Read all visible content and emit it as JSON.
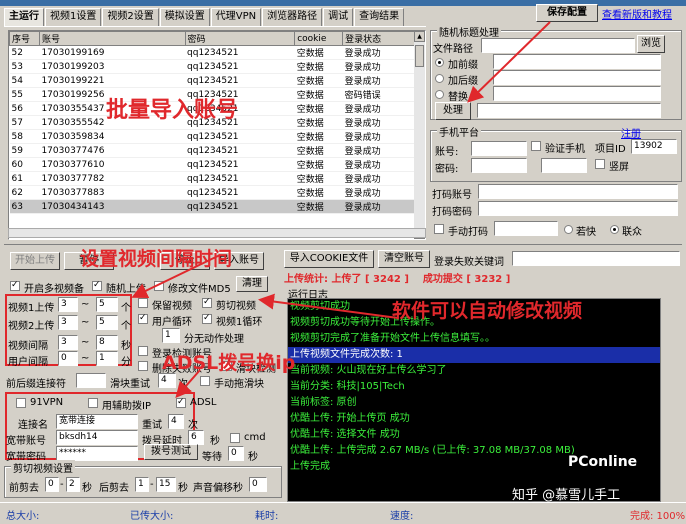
{
  "tabs": [
    "主运行",
    "视频1设置",
    "视频2设置",
    "模拟设置",
    "代理VPN",
    "浏览器路径",
    "调试",
    "查询结果"
  ],
  "save_label": "保存配置",
  "tutorial_link": "查看新版和教程",
  "grid": {
    "headers": [
      "序号",
      "账号",
      "密码",
      "cookie",
      "登录状态"
    ],
    "rows": [
      [
        "52",
        "17030199169",
        "qq1234521",
        "空数据",
        "登录成功"
      ],
      [
        "53",
        "17030199203",
        "qq1234521",
        "空数据",
        "登录成功"
      ],
      [
        "54",
        "17030199221",
        "qq1234521",
        "空数据",
        "登录成功"
      ],
      [
        "55",
        "17030199256",
        "qq1234521",
        "空数据",
        "密码错误"
      ],
      [
        "56",
        "17030355437",
        "qq1234521",
        "空数据",
        "登录成功"
      ],
      [
        "57",
        "17030355542",
        "qq1234521",
        "空数据",
        "登录成功"
      ],
      [
        "58",
        "17030359834",
        "qq1234521",
        "空数据",
        "登录成功"
      ],
      [
        "59",
        "17030377476",
        "qq1234521",
        "空数据",
        "登录成功"
      ],
      [
        "60",
        "17030377610",
        "qq1234521",
        "空数据",
        "登录成功"
      ],
      [
        "61",
        "17030377782",
        "qq1234521",
        "空数据",
        "登录成功"
      ],
      [
        "62",
        "17030377883",
        "qq1234521",
        "空数据",
        "登录成功"
      ],
      [
        "63",
        "17030434143",
        "qq1234521",
        "空数据",
        "登录成功"
      ]
    ]
  },
  "title_proc": {
    "group": "随机标题处理",
    "path_label": "文件路径",
    "browse": "浏览",
    "opt_prefix": "加前缀",
    "opt_suffix": "加后缀",
    "opt_replace": "替换",
    "process": "处理"
  },
  "phone": {
    "group": "手机平台",
    "register": "注册",
    "account_label": "账号:",
    "password_label": "密码:",
    "verify_label": "验证手机",
    "project_label": "项目ID",
    "project_id": "13902",
    "portrait_label": "竖屏"
  },
  "captcha": {
    "account_label": "打码账号",
    "password_label": "打码密码",
    "manual_label": "手动打码",
    "fast_label": "若快",
    "union_label": "联众"
  },
  "toolbar": {
    "start_upload": "开始上传",
    "pause": "暂停",
    "stop": "停止",
    "import_account": "导入账号",
    "import_cookie": "导入COOKIE文件",
    "clear_account": "清空账号",
    "clear": "清理",
    "failed_keyword_label": "登录失败关键词"
  },
  "stats": {
    "upload_label": "上传统计:",
    "uploaded_label": "上传了",
    "uploaded_count": "3242",
    "success_label": "成功提交",
    "success_count": "3232"
  },
  "settings": {
    "multi_video": "开启多视频备",
    "random_upload": "随机上传",
    "modify_md5": "修改文件MD5",
    "video1_upload": "视频1上传",
    "video2_upload": "视频2上传",
    "video_interval": "视频间隔",
    "user_interval": "用户间隔",
    "v1a": "3",
    "v1b": "5",
    "v1u": "个",
    "v2a": "3",
    "v2b": "5",
    "v2u": "个",
    "via": "3",
    "vib": "8",
    "viu": "秒",
    "uia": "0",
    "uib": "1",
    "uiu": "分",
    "tilde": "~",
    "keep_video": "保留视频",
    "cut_video": "剪切视频",
    "user_loop": "用户循环",
    "video1_loop": "视频1循环",
    "split_minutes": "1",
    "split_label": "分无动作处理",
    "login_check": "登录检测账号",
    "delete_fail": "删除失败账号",
    "slide_check": "滑块检测",
    "prefix_label": "前后缀连接符",
    "slide_retry": "滑块重试",
    "slide_retry_count": "4",
    "times": "次",
    "manual_slide": "手动拖滑块"
  },
  "adsl": {
    "vpn": "91VPN",
    "dial": "用辅助拨IP",
    "adsl": "ADSL",
    "conn_label": "连接名",
    "conn_value": "宽带连接",
    "retry_label": "重试",
    "retry_count": "4",
    "times": "次",
    "account_label": "宽带账号",
    "account_value": "bksdh14",
    "delay_label": "拨号延时",
    "delay_value": "6",
    "sec": "秒",
    "cmd": "cmd",
    "password_label": "宽带密码",
    "password_value": "******",
    "test_label": "拨号测试",
    "wait_label": "等待",
    "wait_value": "0"
  },
  "cut": {
    "group": "剪切视频设置",
    "front_label": "前剪去",
    "front_a": "0",
    "front_b": "2",
    "back_label": "后剪去",
    "back_a": "1",
    "back_b": "15",
    "sec": "秒",
    "sound_label": "声音偏移秒",
    "sound_value": "0"
  },
  "log": {
    "group": "运行日志",
    "lines": [
      "视频剪切成功",
      "视频剪切成功等待开始上传操作。",
      "视频剪切完成了准备开始文件上传信息填写。。",
      "上传视频文件完成次数: 1",
      "当前视频: 火山现在好上传么学习了",
      "当前分类: 科技|105|Tech",
      "当前标签: 原创",
      "优酷上传: 开始上传页 成功",
      "优酷上传: 选择文件 成功",
      "优酷上传: 上传完成 2.67 MB/s (已上传: 37.08 MB/37.08 MB)",
      "上传完成"
    ]
  },
  "overlay": {
    "batch_import": "批量导入账号",
    "interval": "设置视频间隔时间",
    "auto_modify": "软件可以自动修改视频",
    "adsl_ip": "ADSL拨号换ip"
  },
  "status": {
    "total_size": "总大小:",
    "uploaded_size": "已传大小:",
    "elapsed": "耗时:",
    "speed": "速度:",
    "done": "完成: 100%"
  },
  "watermark": {
    "zhihu": "知乎 @慕雪儿手工",
    "pconline": "PConline"
  },
  "colors": {
    "accent_red": "#e0282c",
    "console_green": "#3cf03c",
    "console_bg": "#000000",
    "status_blue": "#1a3ea8"
  }
}
